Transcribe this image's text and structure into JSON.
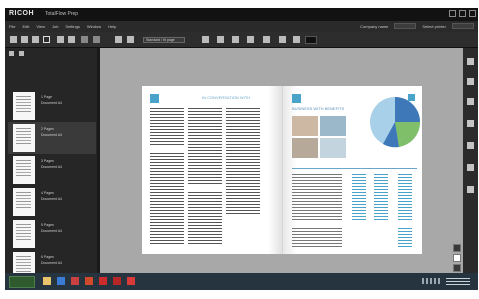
{
  "app": {
    "logo": "RICOH",
    "title": "TotalFlow Prep"
  },
  "menu": {
    "items": [
      "File",
      "Edit",
      "View",
      "Job",
      "Settings",
      "Window",
      "Help"
    ],
    "right_label": "Company name",
    "right_label2": "Select printer"
  },
  "toolbar": {
    "zoom_value": "Standard / fit page"
  },
  "thumbnails": [
    {
      "label": "1 Page",
      "sub": "Document A4"
    },
    {
      "label": "2 Pages",
      "sub": "Document A4"
    },
    {
      "label": "3 Pages",
      "sub": "Document A4"
    },
    {
      "label": "4 Pages",
      "sub": "Document A4"
    },
    {
      "label": "5 Pages",
      "sub": "Document A4"
    },
    {
      "label": "6 Pages",
      "sub": "Document A4"
    }
  ],
  "document": {
    "left_heading": "IN CONVERSATION WITH",
    "right_heading": "BUSINESS WITH BENEFITS"
  },
  "colors": {
    "accent": "#4aa3c8",
    "pie_blue": "#3f78b8",
    "pie_green": "#7fbf6a",
    "pie_light": "#a8d0e8",
    "taskbar": "#25343f"
  }
}
